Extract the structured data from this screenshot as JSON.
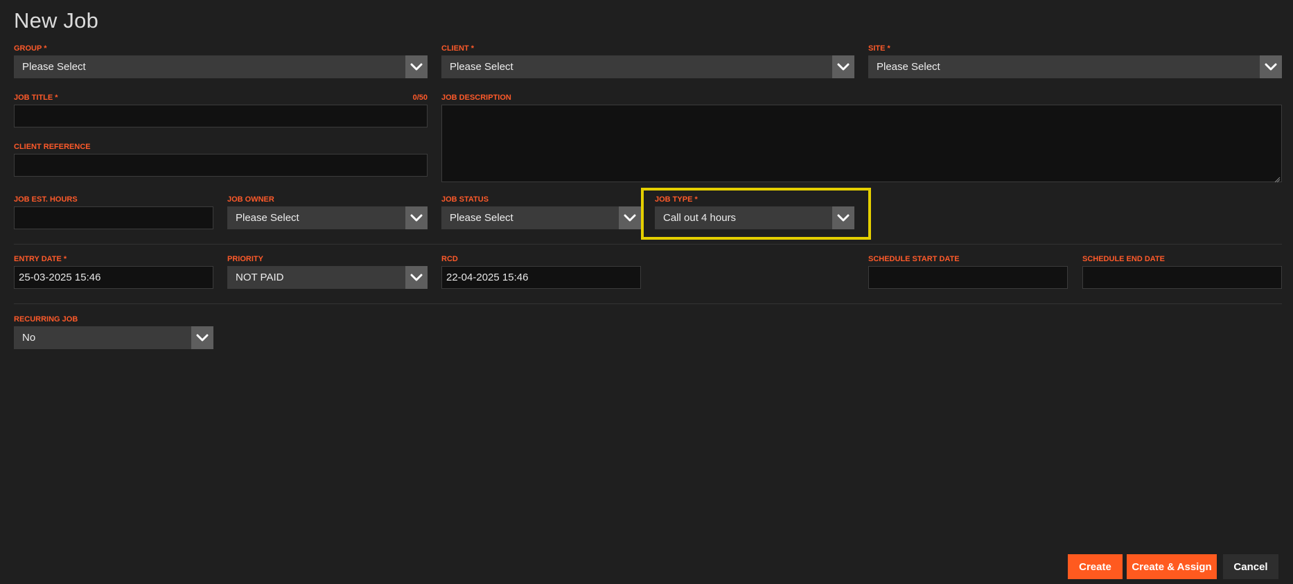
{
  "page": {
    "title": "New Job"
  },
  "fields": {
    "group": {
      "label": "GROUP *",
      "value": "Please Select"
    },
    "client": {
      "label": "CLIENT *",
      "value": "Please Select"
    },
    "site": {
      "label": "SITE *",
      "value": "Please Select"
    },
    "job_title": {
      "label": "JOB TITLE *",
      "counter": "0/50",
      "value": ""
    },
    "job_description": {
      "label": "JOB DESCRIPTION",
      "value": ""
    },
    "client_reference": {
      "label": "CLIENT REFERENCE",
      "value": ""
    },
    "job_est_hours": {
      "label": "JOB EST. HOURS",
      "value": ""
    },
    "job_owner": {
      "label": "JOB OWNER",
      "value": "Please Select"
    },
    "job_status": {
      "label": "JOB STATUS",
      "value": "Please Select"
    },
    "job_type": {
      "label": "JOB TYPE *",
      "value": "Call out 4 hours"
    },
    "entry_date": {
      "label": "ENTRY DATE *",
      "value": "25-03-2025 15:46"
    },
    "priority": {
      "label": "PRIORITY",
      "value": "NOT PAID"
    },
    "rcd": {
      "label": "RCD",
      "value": "22-04-2025 15:46"
    },
    "schedule_start_date": {
      "label": "SCHEDULE START DATE",
      "value": ""
    },
    "schedule_end_date": {
      "label": "SCHEDULE END DATE",
      "value": ""
    },
    "recurring_job": {
      "label": "RECURRING JOB",
      "value": "No"
    }
  },
  "buttons": {
    "create": "Create",
    "create_assign": "Create & Assign",
    "cancel": "Cancel"
  },
  "icons": {
    "dropdown": "chevron-down-icon",
    "resize": "resize-grip-icon"
  },
  "colors": {
    "accent": "#ff5a1f",
    "label": "#ff5a2a",
    "highlight": "#e4cf00",
    "background": "#1f1f1f"
  }
}
